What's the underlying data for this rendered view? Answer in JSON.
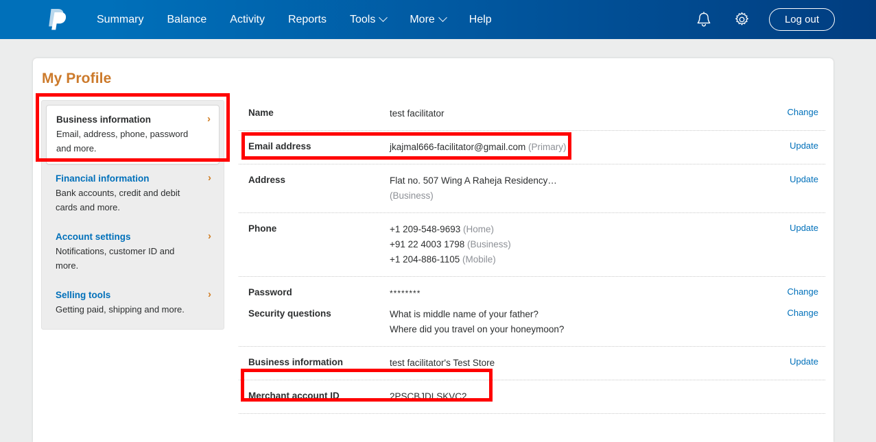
{
  "header": {
    "logo_icon": "paypal-logo-icon",
    "nav": [
      {
        "label": "Summary",
        "caret": false
      },
      {
        "label": "Balance",
        "caret": false
      },
      {
        "label": "Activity",
        "caret": false
      },
      {
        "label": "Reports",
        "caret": false
      },
      {
        "label": "Tools",
        "caret": true
      },
      {
        "label": "More",
        "caret": true
      },
      {
        "label": "Help",
        "caret": false
      }
    ],
    "notifications_icon": "bell-icon",
    "settings_icon": "gear-icon",
    "logout_label": "Log out"
  },
  "page": {
    "title": "My Profile",
    "title_color": "#cc7a2b"
  },
  "sidebar": {
    "items": [
      {
        "title": "Business information",
        "desc": "Email, address, phone, password and more.",
        "chevron": "›",
        "active": true
      },
      {
        "title": "Financial information",
        "desc": "Bank accounts, credit and debit cards and more.",
        "chevron": "›",
        "active": false
      },
      {
        "title": "Account settings",
        "desc": "Notifications, customer ID and more.",
        "chevron": "›",
        "active": false
      },
      {
        "title": "Selling tools",
        "desc": "Getting paid, shipping and more.",
        "chevron": "›",
        "active": false
      }
    ]
  },
  "details": {
    "groups": [
      {
        "rows": [
          {
            "label": "Name",
            "lines": [
              {
                "text": "test facilitator",
                "note": ""
              }
            ],
            "action": "Change"
          }
        ]
      },
      {
        "rows": [
          {
            "label": "Email address",
            "lines": [
              {
                "text": "jkajmal666-facilitator@gmail.com",
                "note": "(Primary)"
              }
            ],
            "action": "Update"
          }
        ]
      },
      {
        "rows": [
          {
            "label": "Address",
            "lines": [
              {
                "text": "Flat no. 507 Wing A Raheja Residency…",
                "note": ""
              },
              {
                "text": "",
                "note": "(Business)"
              }
            ],
            "action": "Update"
          }
        ]
      },
      {
        "rows": [
          {
            "label": "Phone",
            "lines": [
              {
                "text": "+1 209-548-9693",
                "note": "(Home)"
              },
              {
                "text": "+91 22 4003 1798",
                "note": "(Business)"
              },
              {
                "text": "+1 204-886-1105",
                "note": "(Mobile)"
              }
            ],
            "action": "Update"
          }
        ]
      },
      {
        "rows": [
          {
            "label": "Password",
            "password_mask": "********",
            "lines": [],
            "action": "Change"
          },
          {
            "label": "Security questions",
            "lines": [
              {
                "text": "What is middle name of your father?",
                "note": ""
              },
              {
                "text": "Where did you travel on your honeymoon?",
                "note": ""
              }
            ],
            "action": "Change"
          }
        ]
      },
      {
        "rows": [
          {
            "label": "Business information",
            "lines": [
              {
                "text": "test facilitator's Test Store",
                "note": ""
              }
            ],
            "action": "Update"
          }
        ]
      },
      {
        "rows": [
          {
            "label": "Merchant account ID",
            "lines": [
              {
                "text": "2PSCBJDLSKVC2",
                "note": ""
              }
            ],
            "action": ""
          }
        ]
      }
    ]
  },
  "annotations": {
    "color": "#ff0000",
    "boxes": [
      {
        "name": "sidebar-business-information-highlight"
      },
      {
        "name": "email-address-row-highlight"
      },
      {
        "name": "merchant-account-id-row-highlight"
      }
    ]
  }
}
